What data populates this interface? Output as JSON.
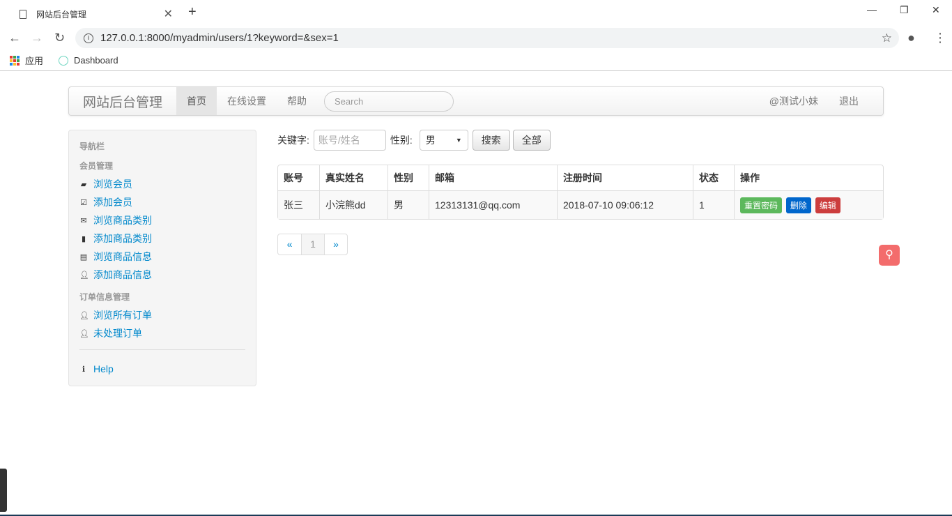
{
  "browser": {
    "tab_title": "网站后台管理",
    "url": "127.0.0.1:8000/myadmin/users/1?keyword=&sex=1",
    "bookmarks": [
      "应用",
      "Dashboard"
    ]
  },
  "navbar": {
    "brand": "网站后台管理",
    "items": [
      "首页",
      "在线设置",
      "帮助"
    ],
    "search_placeholder": "Search",
    "user": "@测试小妹",
    "logout": "退出"
  },
  "sidebar": {
    "title": "导航栏",
    "groups": [
      {
        "title": "会员管理",
        "items": [
          {
            "label": "浏览会员",
            "icon": "folder-open-icon"
          },
          {
            "label": "添加会员",
            "icon": "check-icon"
          },
          {
            "label": "浏览商品类别",
            "icon": "envelope-icon"
          },
          {
            "label": "添加商品类别",
            "icon": "file-icon"
          },
          {
            "label": "浏览商品信息",
            "icon": "list-icon"
          },
          {
            "label": "添加商品信息",
            "icon": "user-icon"
          }
        ]
      },
      {
        "title": "订单信息管理",
        "items": [
          {
            "label": "浏览所有订单",
            "icon": "user-icon"
          },
          {
            "label": "未处理订单",
            "icon": "user-icon"
          }
        ]
      }
    ],
    "help": "Help"
  },
  "filter": {
    "keyword_label": "关键字:",
    "keyword_placeholder": "账号/姓名",
    "sex_label": "性别:",
    "sex_value": "男",
    "search": "搜索",
    "all": "全部"
  },
  "table": {
    "headers": [
      "账号",
      "真实姓名",
      "性别",
      "邮箱",
      "注册时间",
      "状态",
      "操作"
    ],
    "rows": [
      {
        "account": "张三",
        "name": "小浣熊dd",
        "sex": "男",
        "email": "12313131@qq.com",
        "time": "2018-07-10 09:06:12",
        "status": "1"
      }
    ],
    "actions": {
      "reset": "重置密码",
      "delete": "删除",
      "edit": "编辑"
    }
  },
  "colors": {
    "reset": "#5cb85c",
    "delete": "#0066cc",
    "edit": "#cc3d3d",
    "fab": "#f36c6c",
    "link": "#0088cc"
  },
  "pagination": {
    "prev": "«",
    "page": "1",
    "next": "»"
  }
}
